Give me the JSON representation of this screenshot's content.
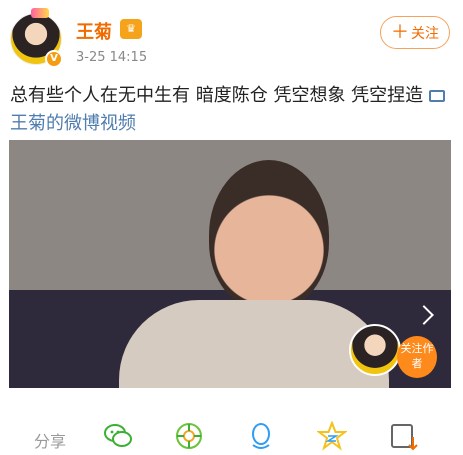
{
  "post": {
    "username": "王菊",
    "timestamp": "3-25 14:15",
    "follow_label": "关注",
    "text": "总有些个人在无中生有 暗度陈仓 凭空想象 凭空捏造",
    "video_link": "王菊的微博视频",
    "author_badge": "关注作者"
  },
  "actions": {
    "share_label": "分享",
    "icons": [
      "wechat-icon",
      "moments-icon",
      "qq-icon",
      "qzone-icon",
      "save-video-icon"
    ]
  },
  "colors": {
    "accent_orange": "#f06b00",
    "link_blue": "#507daf",
    "wechat_green": "#3cb034",
    "qq_blue": "#2f9df3",
    "star_yellow": "#f5c21b"
  }
}
